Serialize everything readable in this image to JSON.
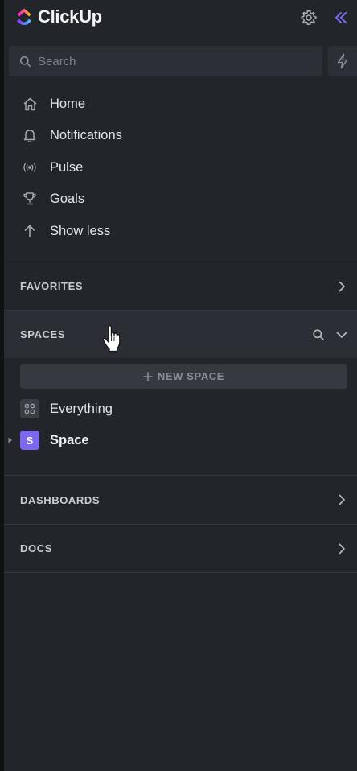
{
  "app": {
    "name": "ClickUp"
  },
  "search": {
    "placeholder": "Search"
  },
  "nav": {
    "items": [
      {
        "label": "Home",
        "icon": "home-icon"
      },
      {
        "label": "Notifications",
        "icon": "bell-icon"
      },
      {
        "label": "Pulse",
        "icon": "pulse-icon"
      },
      {
        "label": "Goals",
        "icon": "trophy-icon"
      },
      {
        "label": "Show less",
        "icon": "arrow-up-icon"
      }
    ]
  },
  "sections": {
    "favorites": "FAVORITES",
    "spaces": "SPACES",
    "dashboards": "DASHBOARDS",
    "docs": "DOCS"
  },
  "spaces": {
    "new_space_label": "NEW SPACE",
    "items": [
      {
        "label": "Everything",
        "icon": "everything-grid-icon"
      },
      {
        "label": "Space",
        "badge": "S",
        "badge_color": "#7b68ee"
      }
    ]
  },
  "colors": {
    "accent": "#7b68ee",
    "sidebar_bg": "#22262b",
    "section_hover_bg": "#2b2f35"
  }
}
